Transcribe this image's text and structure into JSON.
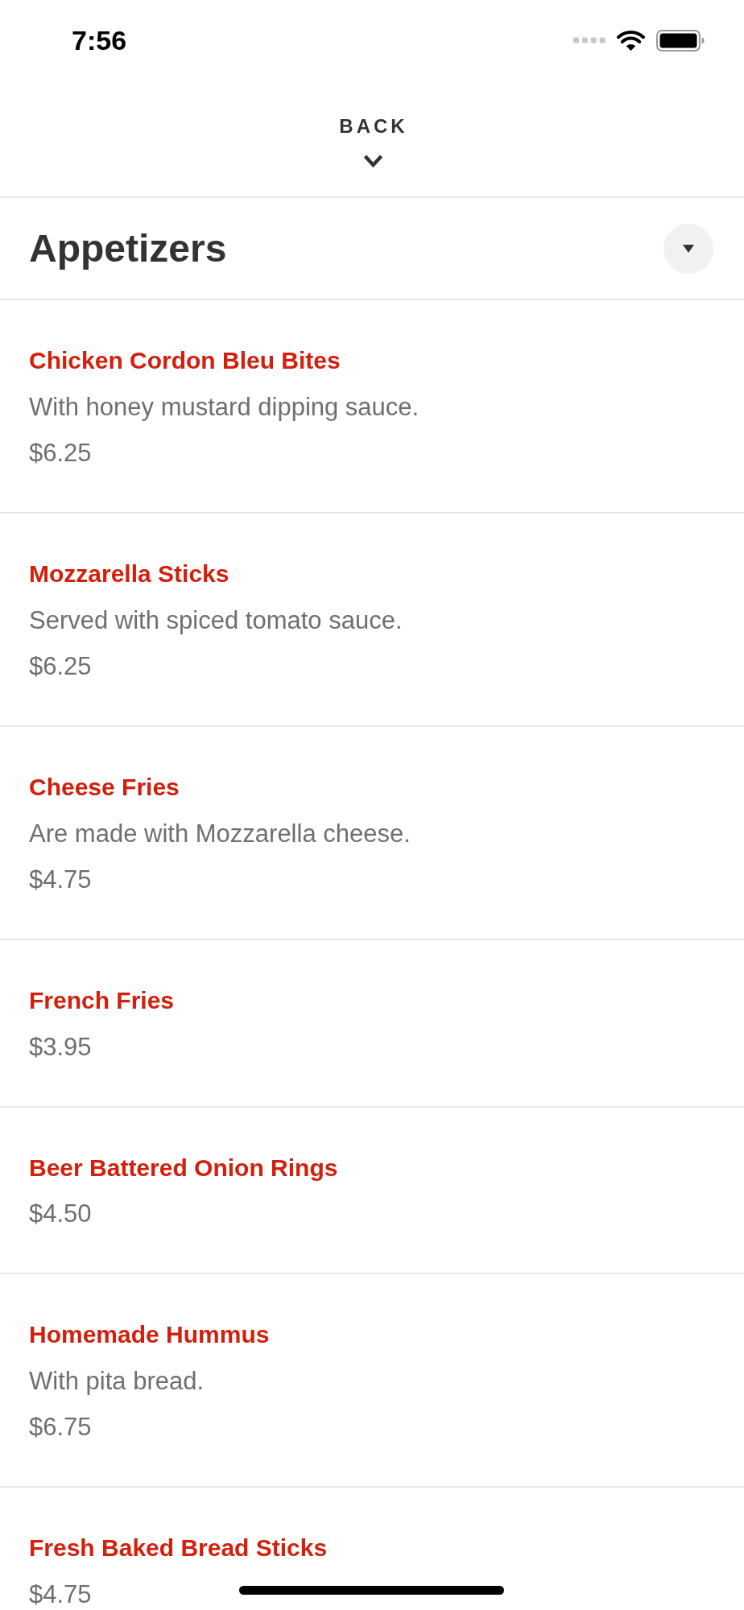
{
  "status_bar": {
    "time": "7:56"
  },
  "back_button": {
    "label": "BACK"
  },
  "section": {
    "title": "Appetizers"
  },
  "menu_items": [
    {
      "name": "Chicken Cordon Bleu Bites",
      "description": "With honey mustard dipping sauce.",
      "price": "$6.25"
    },
    {
      "name": "Mozzarella Sticks",
      "description": "Served with spiced tomato sauce.",
      "price": "$6.25"
    },
    {
      "name": "Cheese Fries",
      "description": "Are made with Mozzarella cheese.",
      "price": "$4.75"
    },
    {
      "name": "French Fries",
      "price": "$3.95"
    },
    {
      "name": "Beer Battered Onion Rings",
      "price": "$4.50"
    },
    {
      "name": "Homemade Hummus",
      "description": "With pita bread.",
      "price": "$6.75"
    },
    {
      "name": "Fresh Baked Bread Sticks",
      "price": "$4.75"
    }
  ]
}
